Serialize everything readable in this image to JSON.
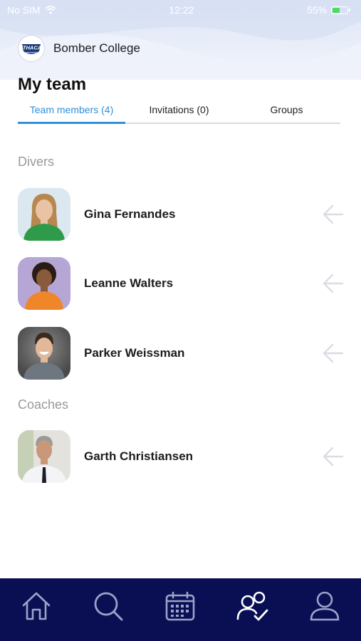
{
  "status_bar": {
    "carrier": "No SIM",
    "time": "12:22",
    "battery": "55%",
    "battery_level": 0.55
  },
  "school": {
    "name": "Bomber College",
    "logo_text": "ITHACA"
  },
  "page": {
    "title": "My team"
  },
  "tabs": [
    {
      "label": "Team members (4)",
      "active": true
    },
    {
      "label": "Invitations (0)",
      "active": false
    },
    {
      "label": "Groups",
      "active": false
    }
  ],
  "sections": {
    "divers": {
      "label": "Divers",
      "members": [
        {
          "name": "Gina Fernandes",
          "bg": "#dce8ef",
          "shirt": "#2e9a4a",
          "hair": "#b8874f",
          "skin": "#e9c3a3"
        },
        {
          "name": "Leanne Walters",
          "bg": "#b6a6d6",
          "shirt": "#f0862a",
          "hair": "#2a1c14",
          "skin": "#8a5a3c"
        },
        {
          "name": "Parker Weissman",
          "bg": "#5d5d5d",
          "shirt": "#6e7780",
          "hair": "#3b2a1e",
          "skin": "#e2b89a"
        }
      ]
    },
    "coaches": {
      "label": "Coaches",
      "members": [
        {
          "name": "Garth Christiansen",
          "bg": "#e4e2dc",
          "shirt": "#f4f4f6",
          "hair": "#9a9a9a",
          "skin": "#c89878"
        }
      ]
    }
  },
  "bottom_nav": [
    {
      "icon": "home-icon",
      "active": false
    },
    {
      "icon": "search-icon",
      "active": false
    },
    {
      "icon": "calendar-icon",
      "active": false
    },
    {
      "icon": "team-icon",
      "active": true
    },
    {
      "icon": "profile-icon",
      "active": false
    }
  ],
  "colors": {
    "accent": "#2f8fd8",
    "nav_bg": "#0a0f54",
    "nav_icon": "#9aa3c7",
    "nav_icon_active": "#ffffff",
    "section_label": "#9a9a9f"
  }
}
